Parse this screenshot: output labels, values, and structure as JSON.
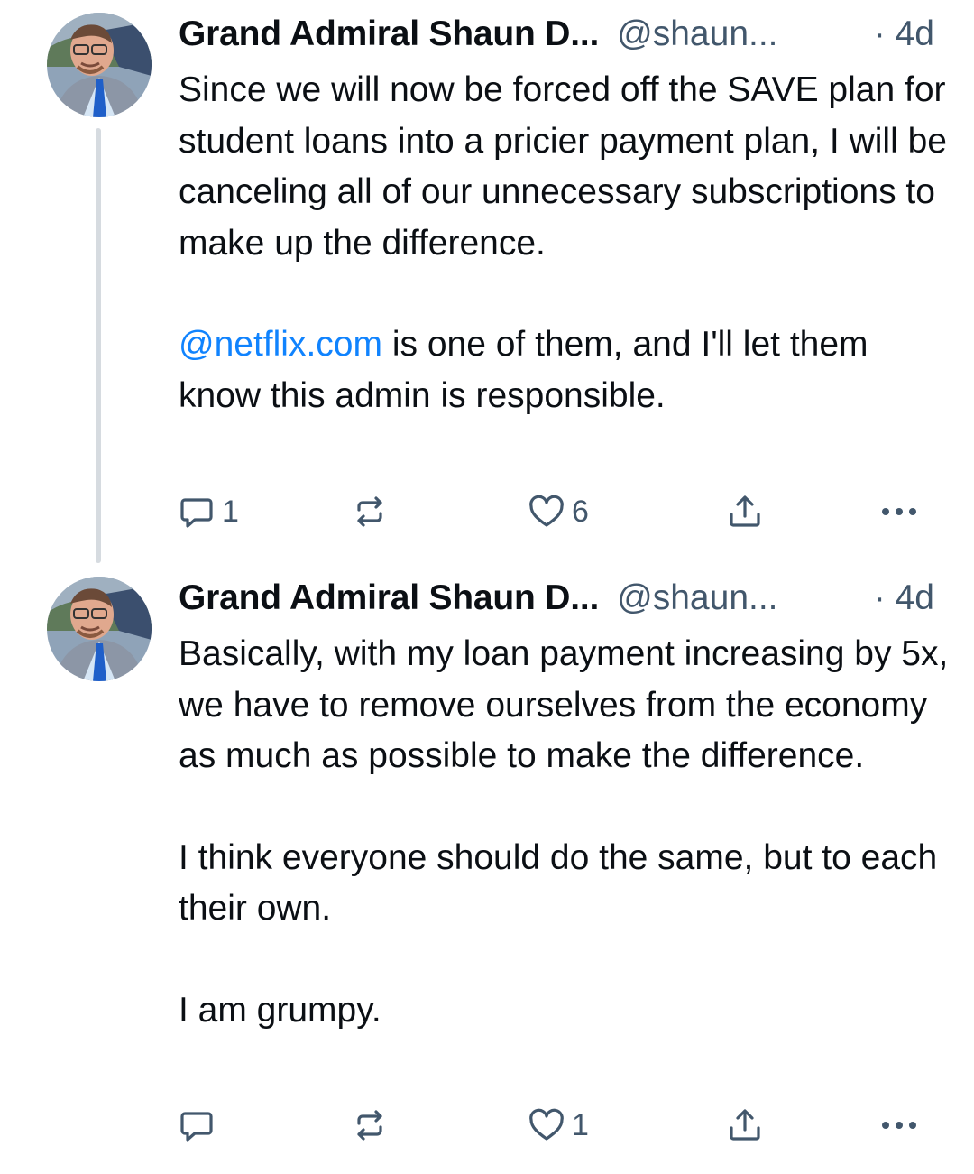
{
  "posts": [
    {
      "author": "Grand Admiral Shaun D...",
      "handle": "@shaun...",
      "time": "· 4d",
      "paragraphs": [
        {
          "text": "Since we will now be forced off the SAVE plan for student loans into a pricier payment plan, I will be canceling all of our unnecessary subscriptions to make up the difference."
        },
        {
          "mention": "@netflix.com",
          "text": " is one of them, and I'll let them know this admin is responsible."
        }
      ],
      "reply_count": "1",
      "repost_count": "",
      "like_count": "6",
      "avatar_icon": "profile-photo"
    },
    {
      "author": "Grand Admiral Shaun D...",
      "handle": "@shaun...",
      "time": "· 4d",
      "paragraphs": [
        {
          "text": "Basically, with my loan payment increasing by 5x, we have to remove ourselves from the economy as much as possible to make the difference."
        },
        {
          "text": "I think everyone should do the same, but to each their own."
        },
        {
          "text": "I am grumpy."
        }
      ],
      "reply_count": "",
      "repost_count": "",
      "like_count": "1",
      "avatar_icon": "profile-photo"
    }
  ],
  "icons": {
    "reply": "reply-icon",
    "repost": "repost-icon",
    "like": "heart-icon",
    "share": "share-icon",
    "more": "more-icon"
  },
  "colors": {
    "text": "#0b0f14",
    "muted": "#42576c",
    "link": "#1083fe",
    "thread_line": "#d6dbe0",
    "background": "#ffffff"
  }
}
